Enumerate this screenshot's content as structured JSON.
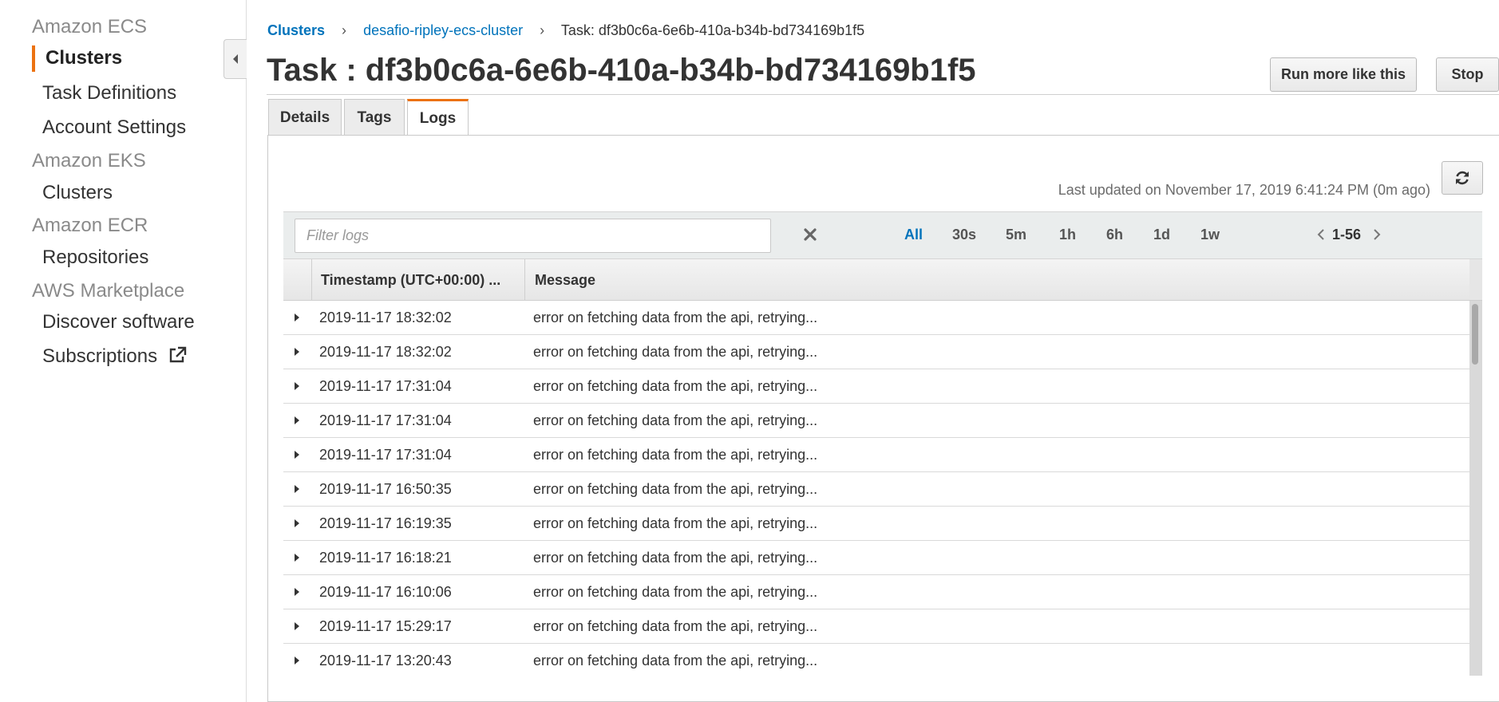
{
  "sidebar": {
    "groups": [
      {
        "title": "Amazon ECS",
        "items": [
          "Clusters",
          "Task Definitions",
          "Account Settings"
        ]
      },
      {
        "title": "Amazon EKS",
        "items": [
          "Clusters"
        ]
      },
      {
        "title": "Amazon ECR",
        "items": [
          "Repositories"
        ]
      },
      {
        "title": "AWS Marketplace",
        "items": [
          "Discover software",
          "Subscriptions"
        ]
      }
    ],
    "active_item": "Clusters"
  },
  "breadcrumb": {
    "items": [
      "Clusters",
      "desafio-ripley-ecs-cluster",
      "Task: df3b0c6a-6e6b-410a-b34b-bd734169b1f5"
    ]
  },
  "page": {
    "title": "Task : df3b0c6a-6e6b-410a-b34b-bd734169b1f5",
    "run_more_label": "Run more like this",
    "stop_label": "Stop"
  },
  "tabs": [
    {
      "label": "Details",
      "active": false
    },
    {
      "label": "Tags",
      "active": false
    },
    {
      "label": "Logs",
      "active": true
    }
  ],
  "logs": {
    "last_updated": "Last updated on November 17, 2019 6:41:24 PM (0m ago)",
    "filter_placeholder": "Filter logs",
    "filter_value": "",
    "time_ranges": [
      {
        "label": "All",
        "active": true
      },
      {
        "label": "30s",
        "active": false
      },
      {
        "label": "5m",
        "active": false
      },
      {
        "label": "1h",
        "active": false
      },
      {
        "label": "6h",
        "active": false
      },
      {
        "label": "1d",
        "active": false
      },
      {
        "label": "1w",
        "active": false
      }
    ],
    "pagination": "1-56",
    "columns": [
      "Timestamp (UTC+00:00) ...",
      "Message"
    ],
    "rows": [
      {
        "timestamp": "2019-11-17 18:32:02",
        "message": "error on fetching data from the api, retrying..."
      },
      {
        "timestamp": "2019-11-17 18:32:02",
        "message": "error on fetching data from the api, retrying..."
      },
      {
        "timestamp": "2019-11-17 17:31:04",
        "message": "error on fetching data from the api, retrying..."
      },
      {
        "timestamp": "2019-11-17 17:31:04",
        "message": "error on fetching data from the api, retrying..."
      },
      {
        "timestamp": "2019-11-17 17:31:04",
        "message": "error on fetching data from the api, retrying..."
      },
      {
        "timestamp": "2019-11-17 16:50:35",
        "message": "error on fetching data from the api, retrying..."
      },
      {
        "timestamp": "2019-11-17 16:19:35",
        "message": "error on fetching data from the api, retrying..."
      },
      {
        "timestamp": "2019-11-17 16:18:21",
        "message": "error on fetching data from the api, retrying..."
      },
      {
        "timestamp": "2019-11-17 16:10:06",
        "message": "error on fetching data from the api, retrying..."
      },
      {
        "timestamp": "2019-11-17 15:29:17",
        "message": "error on fetching data from the api, retrying..."
      },
      {
        "timestamp": "2019-11-17 13:20:43",
        "message": "error on fetching data from the api, retrying..."
      }
    ]
  },
  "colors": {
    "accent_orange": "#ec7211",
    "link_blue": "#0073bb"
  }
}
